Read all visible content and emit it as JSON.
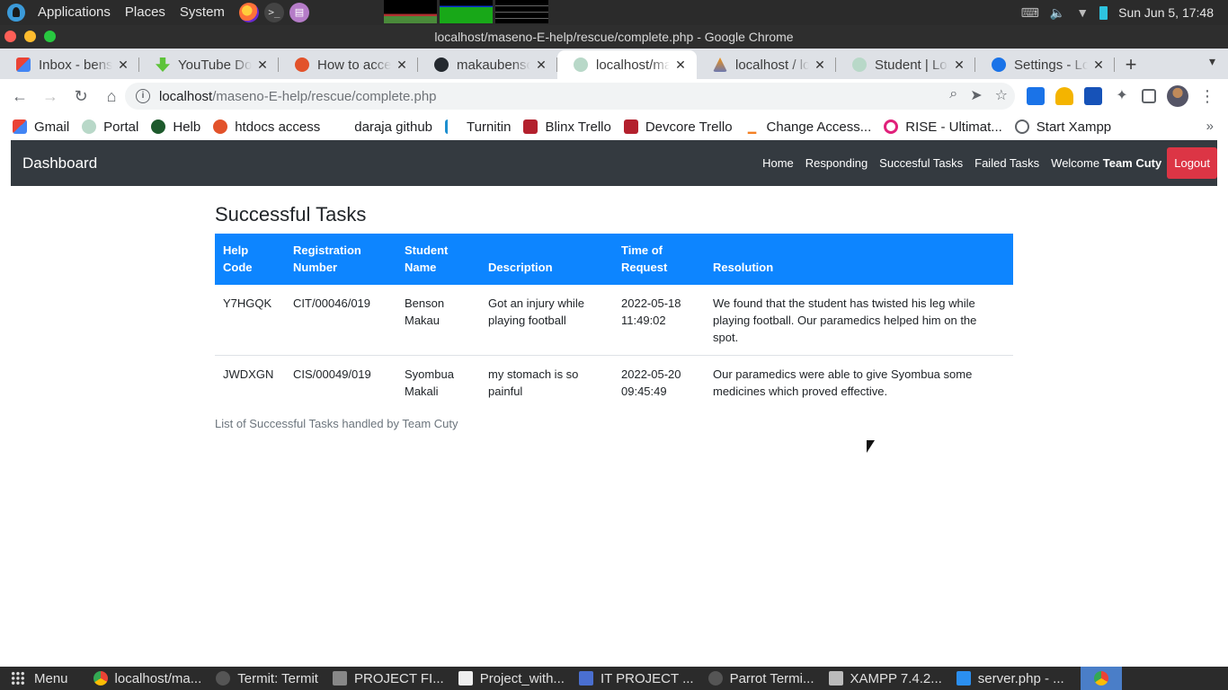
{
  "system_panel": {
    "menus": [
      "Applications",
      "Places",
      "System"
    ],
    "clock": "Sun Jun  5, 17:48"
  },
  "window": {
    "title": "localhost/maseno-E-help/rescue/complete.php - Google Chrome"
  },
  "tabs": [
    {
      "label": "Inbox - benson",
      "icon": "gmail-icon"
    },
    {
      "label": "YouTube Downloader",
      "icon": "download-icon"
    },
    {
      "label": "How to access",
      "icon": "ask-icon"
    },
    {
      "label": "makaubenson",
      "icon": "github-icon"
    },
    {
      "label": "localhost/maseno",
      "icon": "maseno-icon",
      "active": true
    },
    {
      "label": "localhost / localhost",
      "icon": "phpmyadmin-icon"
    },
    {
      "label": "Student | Login",
      "icon": "maseno-icon"
    },
    {
      "label": "Settings - Location",
      "icon": "settings-gear-icon"
    }
  ],
  "address_bar": {
    "host": "localhost",
    "path": "/maseno-E-help/rescue/complete.php"
  },
  "bookmarks": [
    "Gmail",
    "Portal",
    "Helb",
    "htdocs access",
    "daraja github",
    "Turnitin",
    "Blinx Trello",
    "Devcore Trello",
    "Change Access...",
    "RISE - Ultimat...",
    "Start Xampp"
  ],
  "navbar": {
    "brand": "Dashboard",
    "links": [
      "Home",
      "Responding",
      "Succesful Tasks",
      "Failed Tasks"
    ],
    "welcome_prefix": "Welcome",
    "team_name": "Team Cuty",
    "logout": "Logout",
    "logout_color": "#dc3545",
    "bg_color": "#343a40"
  },
  "main": {
    "heading": "Successful Tasks",
    "table": {
      "header_color": "#0d85ff",
      "columns": [
        "Help Code",
        "Registration Number",
        "Student Name",
        "Description",
        "Time of Request",
        "Resolution"
      ],
      "rows": [
        [
          "Y7HGQK",
          "CIT/00046/019",
          "Benson Makau",
          "Got an injury while playing football",
          "2022-05-18 11:49:02",
          "We found that the student has twisted his leg while playing football. Our paramedics helped him on the spot."
        ],
        [
          "JWDXGN",
          "CIS/00049/019",
          "Syombua Makali",
          "my stomach is so painful",
          "2022-05-20 09:45:49",
          "Our paramedics were able to give Syombua some medicines which proved effective."
        ]
      ]
    },
    "caption": "List of Successful Tasks handled by Team Cuty"
  },
  "taskbar": {
    "menu_label": "Menu",
    "items": [
      {
        "label": "localhost/ma...",
        "icon": "chrome-icon"
      },
      {
        "label": "Termit: Termit",
        "icon": "terminal-icon"
      },
      {
        "label": "PROJECT FI...",
        "icon": "folder-icon"
      },
      {
        "label": "Project_with...",
        "icon": "document-icon"
      },
      {
        "label": "IT PROJECT ...",
        "icon": "text-document-icon"
      },
      {
        "label": "Parrot Termi...",
        "icon": "terminal-icon"
      },
      {
        "label": "XAMPP 7.4.2...",
        "icon": "xampp-icon"
      },
      {
        "label": "server.php - ...",
        "icon": "vscode-icon"
      }
    ]
  }
}
